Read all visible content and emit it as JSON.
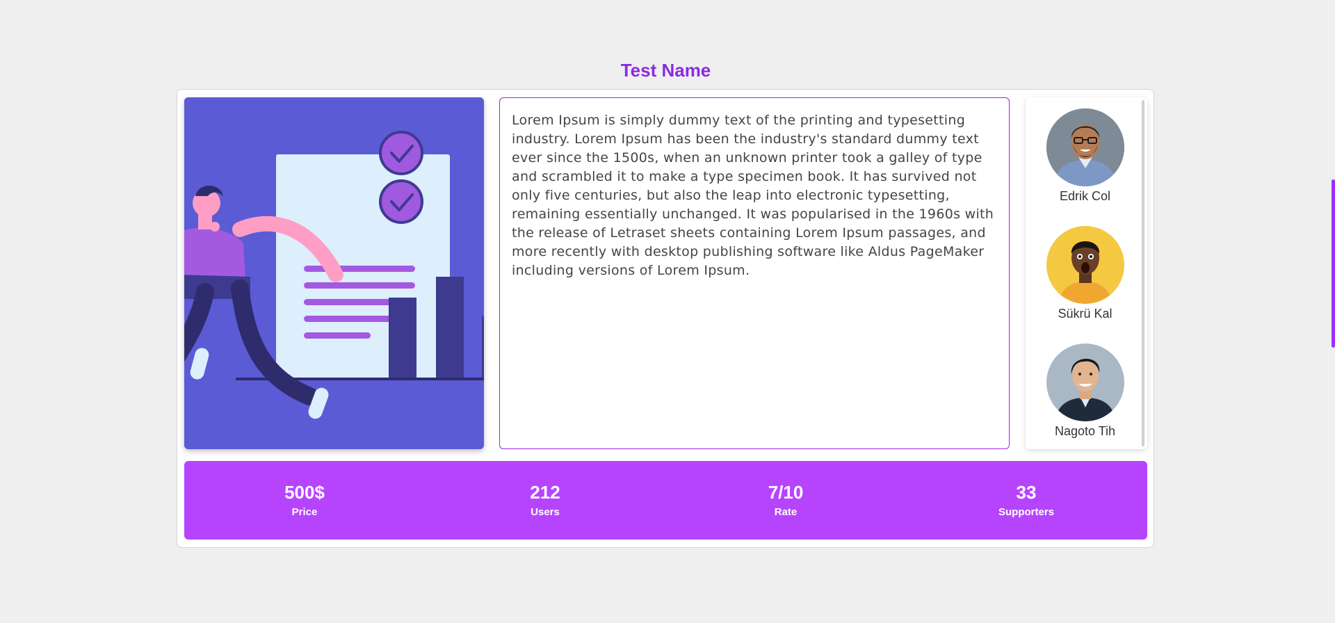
{
  "header": {
    "title": "Test Name"
  },
  "description": "Lorem Ipsum is simply dummy text of the printing and typesetting industry. Lorem Ipsum has been the industry's standard dummy text ever since the 1500s, when an unknown printer took a galley of type and scrambled it to make a type specimen book. It has survived not only five centuries, but also the leap into electronic typesetting, remaining essentially unchanged. It was popularised in the 1960s with the release of Letraset sheets containing Lorem Ipsum passages, and more recently with desktop publishing software like Aldus PageMaker including versions of Lorem Ipsum.",
  "supporters": [
    {
      "name": "Edrik Col"
    },
    {
      "name": "Sükrü Kal"
    },
    {
      "name": "Nagoto Tih"
    }
  ],
  "stats": [
    {
      "value": "500$",
      "label": "Price"
    },
    {
      "value": "212",
      "label": "Users"
    },
    {
      "value": "7/10",
      "label": "Rate"
    },
    {
      "value": "33",
      "label": "Supporters"
    }
  ],
  "colors": {
    "accent": "#8a2be2",
    "stats_bg": "#b744fd",
    "illustration_bg": "#5b5bd6"
  }
}
